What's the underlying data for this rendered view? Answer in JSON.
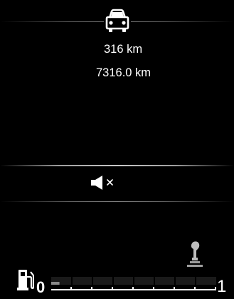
{
  "trip": {
    "range": "316 km",
    "odometer": "7316.0 km"
  },
  "fuel_gauge": {
    "min_label": "0",
    "max_label": "1",
    "level": 0.05,
    "segments": 8
  },
  "icons": {
    "top": "car-icon",
    "audio": "mute-icon",
    "gear": "gear-shift-icon",
    "fuel": "fuel-pump-icon"
  },
  "colors": {
    "background": "#000000",
    "text": "#ffffff",
    "fuel_fill": "#8a8a8a"
  }
}
